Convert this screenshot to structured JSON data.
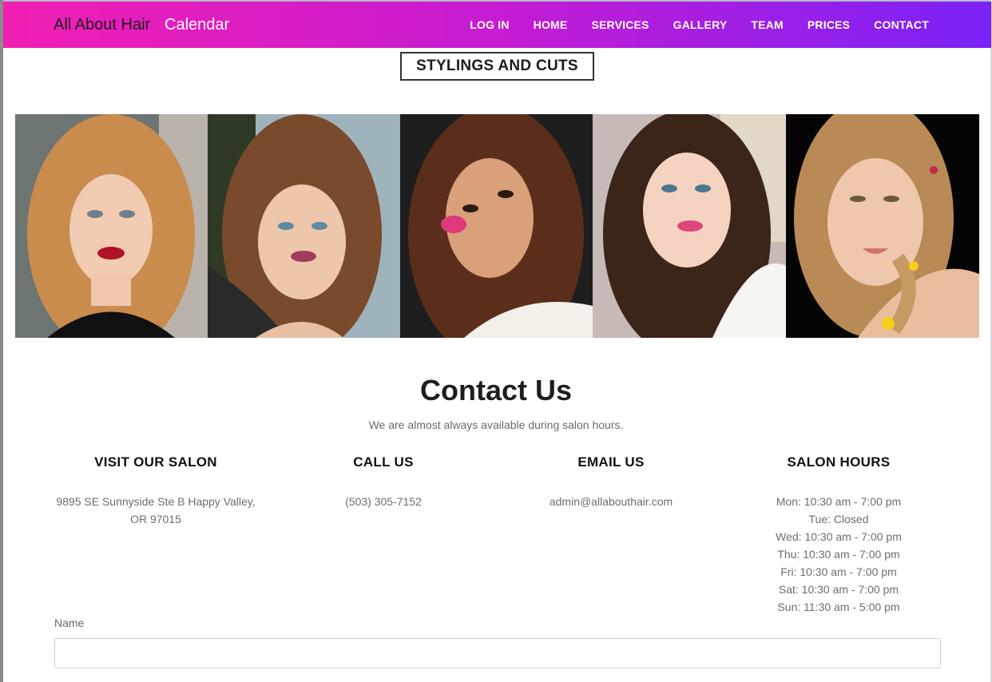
{
  "navbar": {
    "brand": "All About Hair",
    "calendar_link": "Calendar",
    "links": [
      "LOG IN",
      "HOME",
      "SERVICES",
      "GALLERY",
      "TEAM",
      "PRICES",
      "CONTACT"
    ],
    "gradient_start": "#f21fb3",
    "gradient_end": "#7a22f7"
  },
  "gallery": {
    "title": "STYLINGS AND CUTS",
    "photos": [
      {
        "name": "gallery-photo-1",
        "subject": "woman with curly blonde hair",
        "hair_color": "#c98c4d",
        "bg_color": "#6d7572"
      },
      {
        "name": "gallery-photo-2",
        "subject": "woman with braided brown hair",
        "hair_color": "#7a4a2c",
        "bg_color": "#9fb3bd"
      },
      {
        "name": "gallery-photo-3",
        "subject": "woman with dark brown hair",
        "hair_color": "#5a2e1a",
        "bg_color": "#1e1e1e"
      },
      {
        "name": "gallery-photo-4",
        "subject": "woman with long dark wavy hair",
        "hair_color": "#3b2418",
        "bg_color": "#c7b9b6"
      },
      {
        "name": "gallery-photo-5",
        "subject": "smiling woman with braid and flowers",
        "hair_color": "#b98a55",
        "bg_color": "#050505"
      }
    ]
  },
  "contact": {
    "title": "Contact Us",
    "subtitle": "We are almost always available during salon hours.",
    "visit": {
      "heading": "VISIT OUR SALON",
      "address_line1": "9895 SE Sunnyside Ste B Happy Valley,",
      "address_line2": "OR 97015"
    },
    "call": {
      "heading": "CALL US",
      "phone": "(503) 305-7152"
    },
    "email": {
      "heading": "EMAIL US",
      "address": "admin@allabouthair.com"
    },
    "hours": {
      "heading": "SALON HOURS",
      "lines": [
        "Mon: 10:30 am - 7:00 pm",
        "Tue: Closed",
        "Wed: 10:30 am - 7:00 pm",
        "Thu: 10:30 am - 7:00 pm",
        "Fri: 10:30 am - 7:00 pm",
        "Sat: 10:30 am - 7:00 pm",
        "Sun: 11:30 am - 5:00 pm"
      ]
    },
    "form": {
      "name_label": "Name",
      "name_value": ""
    }
  }
}
